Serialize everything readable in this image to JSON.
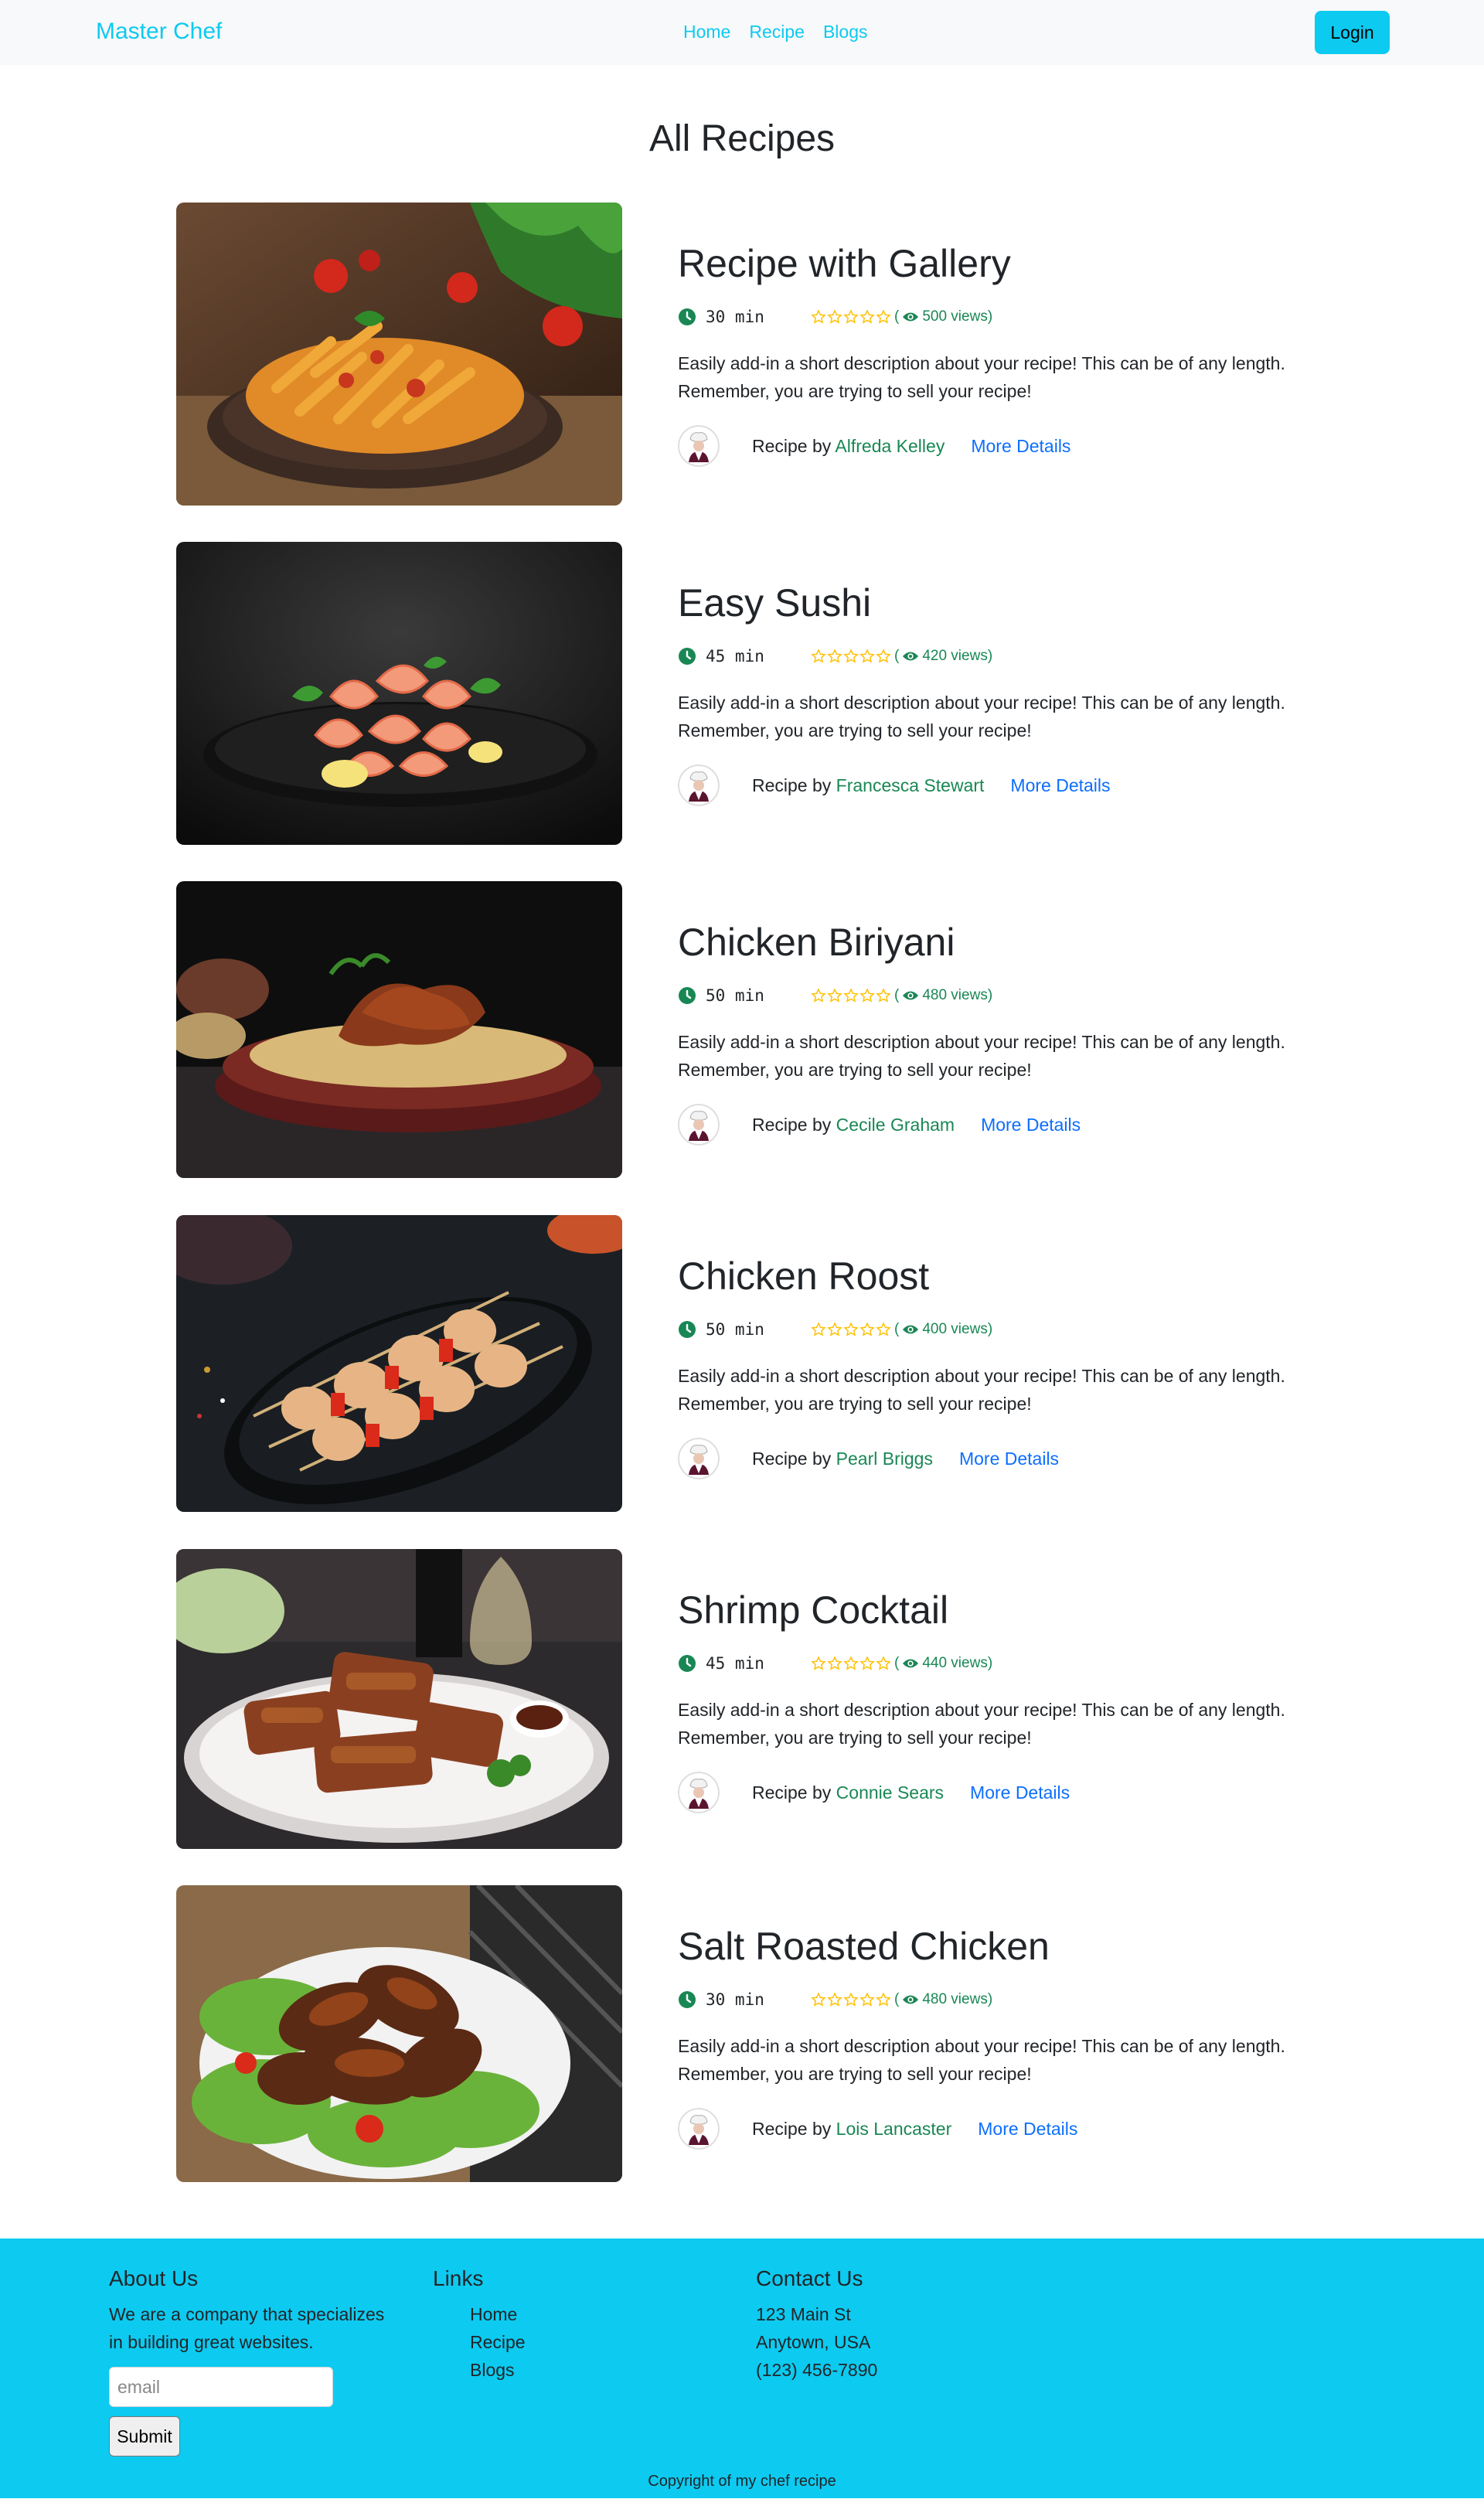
{
  "navbar": {
    "brand": "Master Chef",
    "links": [
      "Home",
      "Recipe",
      "Blogs"
    ],
    "login_label": "Login"
  },
  "page_title": "All Recipes",
  "recipes": [
    {
      "title": "Recipe with Gallery",
      "time": "30 min",
      "views": "( 500 views)",
      "views_count": "500 views",
      "description": "Easily add-in a short description about your recipe! This can be of any length. Remember, you are trying to sell your recipe!",
      "by_label": "Recipe by ",
      "author": "Alfreda Kelley",
      "more_label": "More Details",
      "image": "pasta"
    },
    {
      "title": "Easy Sushi",
      "time": "45 min",
      "views_count": "420 views",
      "description": "Easily add-in a short description about your recipe! This can be of any length. Remember, you are trying to sell your recipe!",
      "by_label": "Recipe by ",
      "author": "Francesca Stewart",
      "more_label": "More Details",
      "image": "shrimp"
    },
    {
      "title": "Chicken Biriyani",
      "time": "50 min",
      "views_count": "480 views",
      "description": "Easily add-in a short description about your recipe! This can be of any length. Remember, you are trying to sell your recipe!",
      "by_label": "Recipe by ",
      "author": "Cecile Graham",
      "more_label": "More Details",
      "image": "biriyani"
    },
    {
      "title": "Chicken Roost",
      "time": "50 min",
      "views_count": "400 views",
      "description": "Easily add-in a short description about your recipe! This can be of any length. Remember, you are trying to sell your recipe!",
      "by_label": "Recipe by ",
      "author": "Pearl Briggs",
      "more_label": "More Details",
      "image": "skewers"
    },
    {
      "title": "Shrimp Cocktail",
      "time": "45 min",
      "views_count": "440 views",
      "description": "Easily add-in a short description about your recipe! This can be of any length. Remember, you are trying to sell your recipe!",
      "by_label": "Recipe by ",
      "author": "Connie Sears",
      "more_label": "More Details",
      "image": "ribs"
    },
    {
      "title": "Salt Roasted Chicken",
      "time": "30 min",
      "views_count": "480 views",
      "description": "Easily add-in a short description about your recipe! This can be of any length. Remember, you are trying to sell your recipe!",
      "by_label": "Recipe by ",
      "author": "Lois Lancaster",
      "more_label": "More Details",
      "image": "wings"
    }
  ],
  "footer": {
    "about_title": "About Us",
    "about_text": "We are a company that specializes in building great websites.",
    "email_placeholder": "email",
    "submit_label": "Submit",
    "links_title": "Links",
    "links": [
      "Home",
      "Recipe",
      "Blogs"
    ],
    "contact_title": "Contact Us",
    "contact_lines": [
      "123 Main St",
      "Anytown, USA",
      "(123) 456-7890"
    ],
    "copyright": "Copyright of my chef recipe"
  },
  "colors": {
    "accent": "#0dcaf0",
    "author": "#198754",
    "link": "#0d6efd",
    "star": "#ffc107",
    "navbar_bg": "#f8f9fa"
  },
  "icons": [
    "clock-icon",
    "star-outline-icon",
    "eye-icon",
    "chef-avatar-icon"
  ]
}
